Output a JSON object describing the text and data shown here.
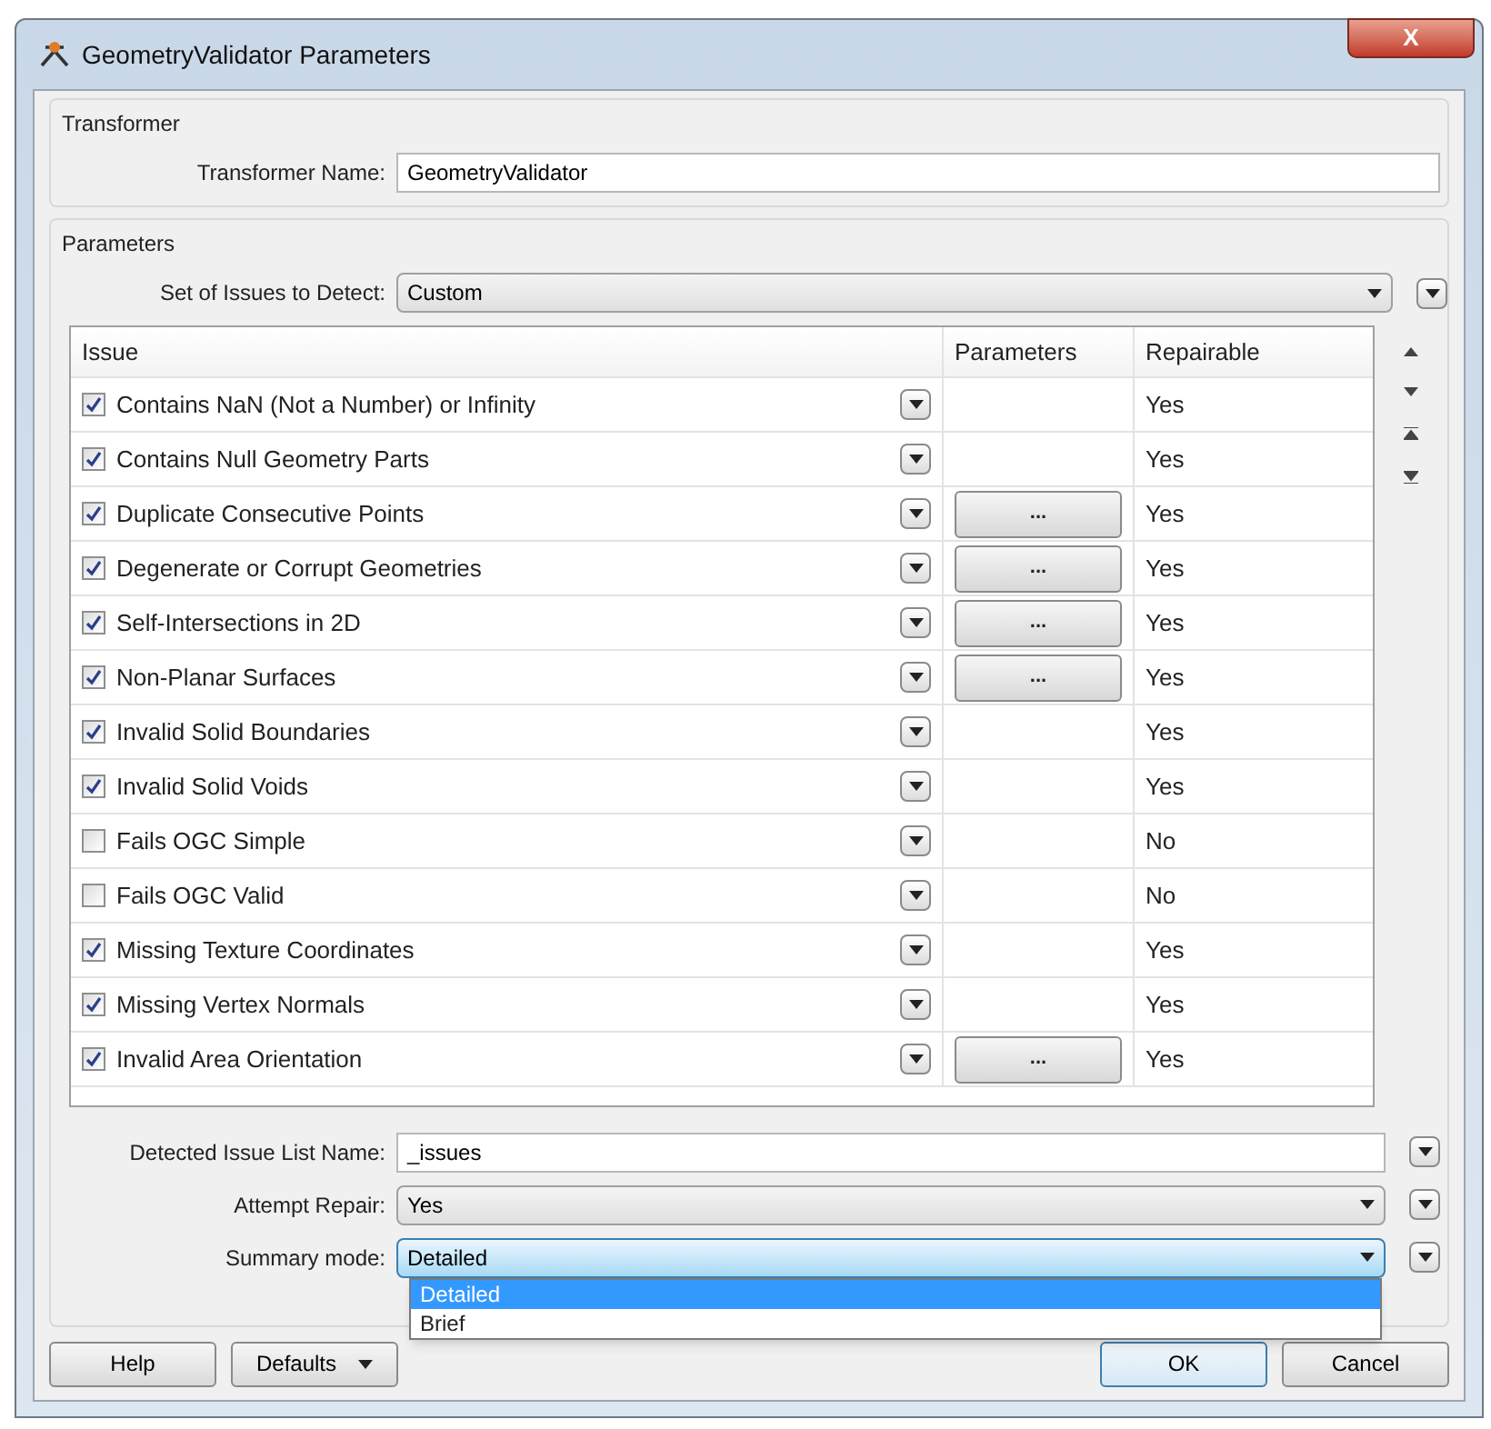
{
  "window": {
    "title": "GeometryValidator Parameters",
    "close": "X"
  },
  "transformer": {
    "group_label": "Transformer",
    "name_label": "Transformer Name:",
    "name_value": "GeometryValidator"
  },
  "parameters": {
    "group_label": "Parameters",
    "set_label": "Set of Issues to Detect:",
    "set_value": "Custom",
    "table": {
      "columns": [
        "Issue",
        "Parameters",
        "Repairable"
      ],
      "rows": [
        {
          "checked": true,
          "issue": "Contains NaN (Not a Number) or Infinity",
          "has_parameters": false,
          "repairable": "Yes"
        },
        {
          "checked": true,
          "issue": "Contains Null Geometry Parts",
          "has_parameters": false,
          "repairable": "Yes"
        },
        {
          "checked": true,
          "issue": "Duplicate Consecutive Points",
          "has_parameters": true,
          "parameters_button": "...",
          "repairable": "Yes"
        },
        {
          "checked": true,
          "issue": "Degenerate or Corrupt Geometries",
          "has_parameters": true,
          "parameters_button": "...",
          "repairable": "Yes"
        },
        {
          "checked": true,
          "issue": "Self-Intersections in 2D",
          "has_parameters": true,
          "parameters_button": "...",
          "repairable": "Yes"
        },
        {
          "checked": true,
          "issue": "Non-Planar Surfaces",
          "has_parameters": true,
          "parameters_button": "...",
          "repairable": "Yes"
        },
        {
          "checked": true,
          "issue": "Invalid Solid Boundaries",
          "has_parameters": false,
          "repairable": "Yes"
        },
        {
          "checked": true,
          "issue": "Invalid Solid Voids",
          "has_parameters": false,
          "repairable": "Yes"
        },
        {
          "checked": false,
          "issue": "Fails OGC Simple",
          "has_parameters": false,
          "repairable": "No"
        },
        {
          "checked": false,
          "issue": "Fails OGC Valid",
          "has_parameters": false,
          "repairable": "No"
        },
        {
          "checked": true,
          "issue": "Missing Texture Coordinates",
          "has_parameters": false,
          "repairable": "Yes"
        },
        {
          "checked": true,
          "issue": "Missing Vertex Normals",
          "has_parameters": false,
          "repairable": "Yes"
        },
        {
          "checked": true,
          "issue": "Invalid Area Orientation",
          "has_parameters": true,
          "parameters_button": "...",
          "repairable": "Yes"
        }
      ]
    },
    "fields": [
      {
        "kind": "text",
        "label": "Detected Issue List Name:",
        "value": "_issues"
      },
      {
        "kind": "select",
        "label": "Attempt Repair:",
        "value": "Yes"
      },
      {
        "kind": "select",
        "label": "Summary mode:",
        "value": "Detailed",
        "open": true,
        "options": [
          {
            "label": "Detailed",
            "selected": true
          },
          {
            "label": "Brief",
            "selected": false
          }
        ]
      }
    ]
  },
  "buttons": {
    "help": "Help",
    "defaults": "Defaults",
    "ok": "OK",
    "cancel": "Cancel"
  }
}
